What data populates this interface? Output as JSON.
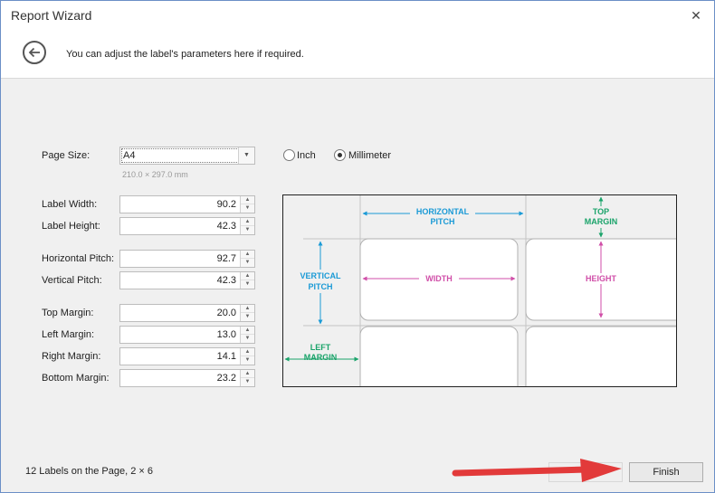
{
  "window": {
    "title": "Report Wizard"
  },
  "header": {
    "instruction": "You can adjust the label's parameters here if required."
  },
  "page_size": {
    "label": "Page Size:",
    "value": "A4",
    "dimensions": "210.0 × 297.0 mm"
  },
  "units": {
    "inch_label": "Inch",
    "millimeter_label": "Millimeter",
    "selected": "Millimeter"
  },
  "fields": {
    "label_width": {
      "label": "Label Width:",
      "value": "90.2"
    },
    "label_height": {
      "label": "Label Height:",
      "value": "42.3"
    },
    "horizontal_pitch": {
      "label": "Horizontal Pitch:",
      "value": "92.7"
    },
    "vertical_pitch": {
      "label": "Vertical Pitch:",
      "value": "42.3"
    },
    "top_margin": {
      "label": "Top Margin:",
      "value": "20.0"
    },
    "left_margin": {
      "label": "Left Margin:",
      "value": "13.0"
    },
    "right_margin": {
      "label": "Right Margin:",
      "value": "14.1"
    },
    "bottom_margin": {
      "label": "Bottom Margin:",
      "value": "23.2"
    }
  },
  "diagram": {
    "horizontal_pitch_l1": "HORIZONTAL",
    "horizontal_pitch_l2": "PITCH",
    "top_margin_l1": "TOP",
    "top_margin_l2": "MARGIN",
    "vertical_pitch_l1": "VERTICAL",
    "vertical_pitch_l2": "PITCH",
    "width": "WIDTH",
    "height": "HEIGHT",
    "left_margin_l1": "LEFT",
    "left_margin_l2": "MARGIN",
    "colors": {
      "pitch": "#1a9ad6",
      "margin": "#1aa36a",
      "size": "#d04ea8"
    }
  },
  "footer": {
    "summary": "12 Labels on the Page, 2 × 6",
    "finish_label": "Finish"
  },
  "icons": {
    "back": "back-arrow-icon",
    "close": "close-icon"
  }
}
